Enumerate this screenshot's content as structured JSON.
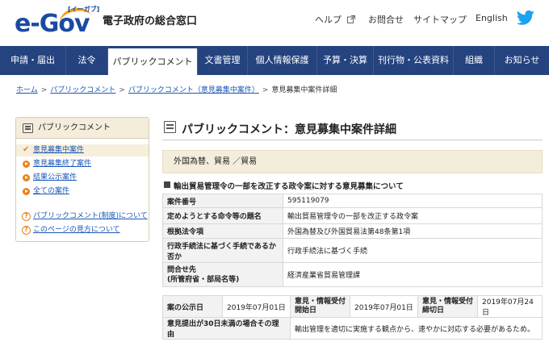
{
  "header": {
    "logo_text": "e-Gov",
    "logo_kana": "[イーガブ]",
    "site_title": "電子政府の総合窓口",
    "links": {
      "help": "ヘルプ",
      "inquiry": "お問合せ",
      "sitemap": "サイトマップ",
      "english": "English"
    }
  },
  "nav": {
    "items": [
      "申請・届出",
      "法令",
      "パブリックコメント",
      "文書管理",
      "個人情報保護",
      "予算・決算",
      "刊行物・公表資料",
      "組織",
      "お知らせ"
    ],
    "active_index": 2
  },
  "breadcrumb": {
    "home": "ホーム",
    "public_comment": "パブリックコメント",
    "open_cases": "パブリックコメント（意見募集中案件）",
    "current": "意見募集中案件詳細",
    "separator": ">"
  },
  "sidebar": {
    "title": "パブリックコメント",
    "items": [
      "意見募集中案件",
      "意見募集終了案件",
      "結果公示案件",
      "全ての案件"
    ],
    "help_items": [
      "パブリックコメント(制度)について",
      "このページの見方について"
    ]
  },
  "main": {
    "title": "パブリックコメント：意見募集中案件詳細",
    "category": "外国為替、貿易 ／貿易",
    "subject": "輸出貿易管理令の一部を改正する政令案に対する意見募集について",
    "info_rows": [
      {
        "key": "案件番号",
        "value": "595119079"
      },
      {
        "key": "定めようとする命令等の題名",
        "value": "輸出貿易管理令の一部を改正する政令案"
      },
      {
        "key": "根拠法令項",
        "value": "外国為替及び外国貿易法第48条第1項"
      },
      {
        "key": "行政手続法に基づく手続であるか否か",
        "value": "行政手続法に基づく手続"
      },
      {
        "key": "問合せ先\n(所管府省・部局名等)",
        "value": "経済産業省貿易管理課"
      }
    ],
    "dates": {
      "announce_label": "案の公示日",
      "announce_date": "2019年07月01日",
      "start_label": "意見・情報受付開始日",
      "start_date": "2019年07月01日",
      "end_label": "意見・情報受付締切日",
      "end_date": "2019年07月24日",
      "reason_label": "意見提出が30日未満の場合その理由",
      "reason_value": "輸出管理を適切に実施する観点から、速やかに対応する必要があるため。"
    }
  },
  "colors": {
    "nav_bg": "#24437f",
    "accent_orange": "#e8821e",
    "link": "#1a57b8",
    "sidebar_head": "#f4eddb"
  }
}
